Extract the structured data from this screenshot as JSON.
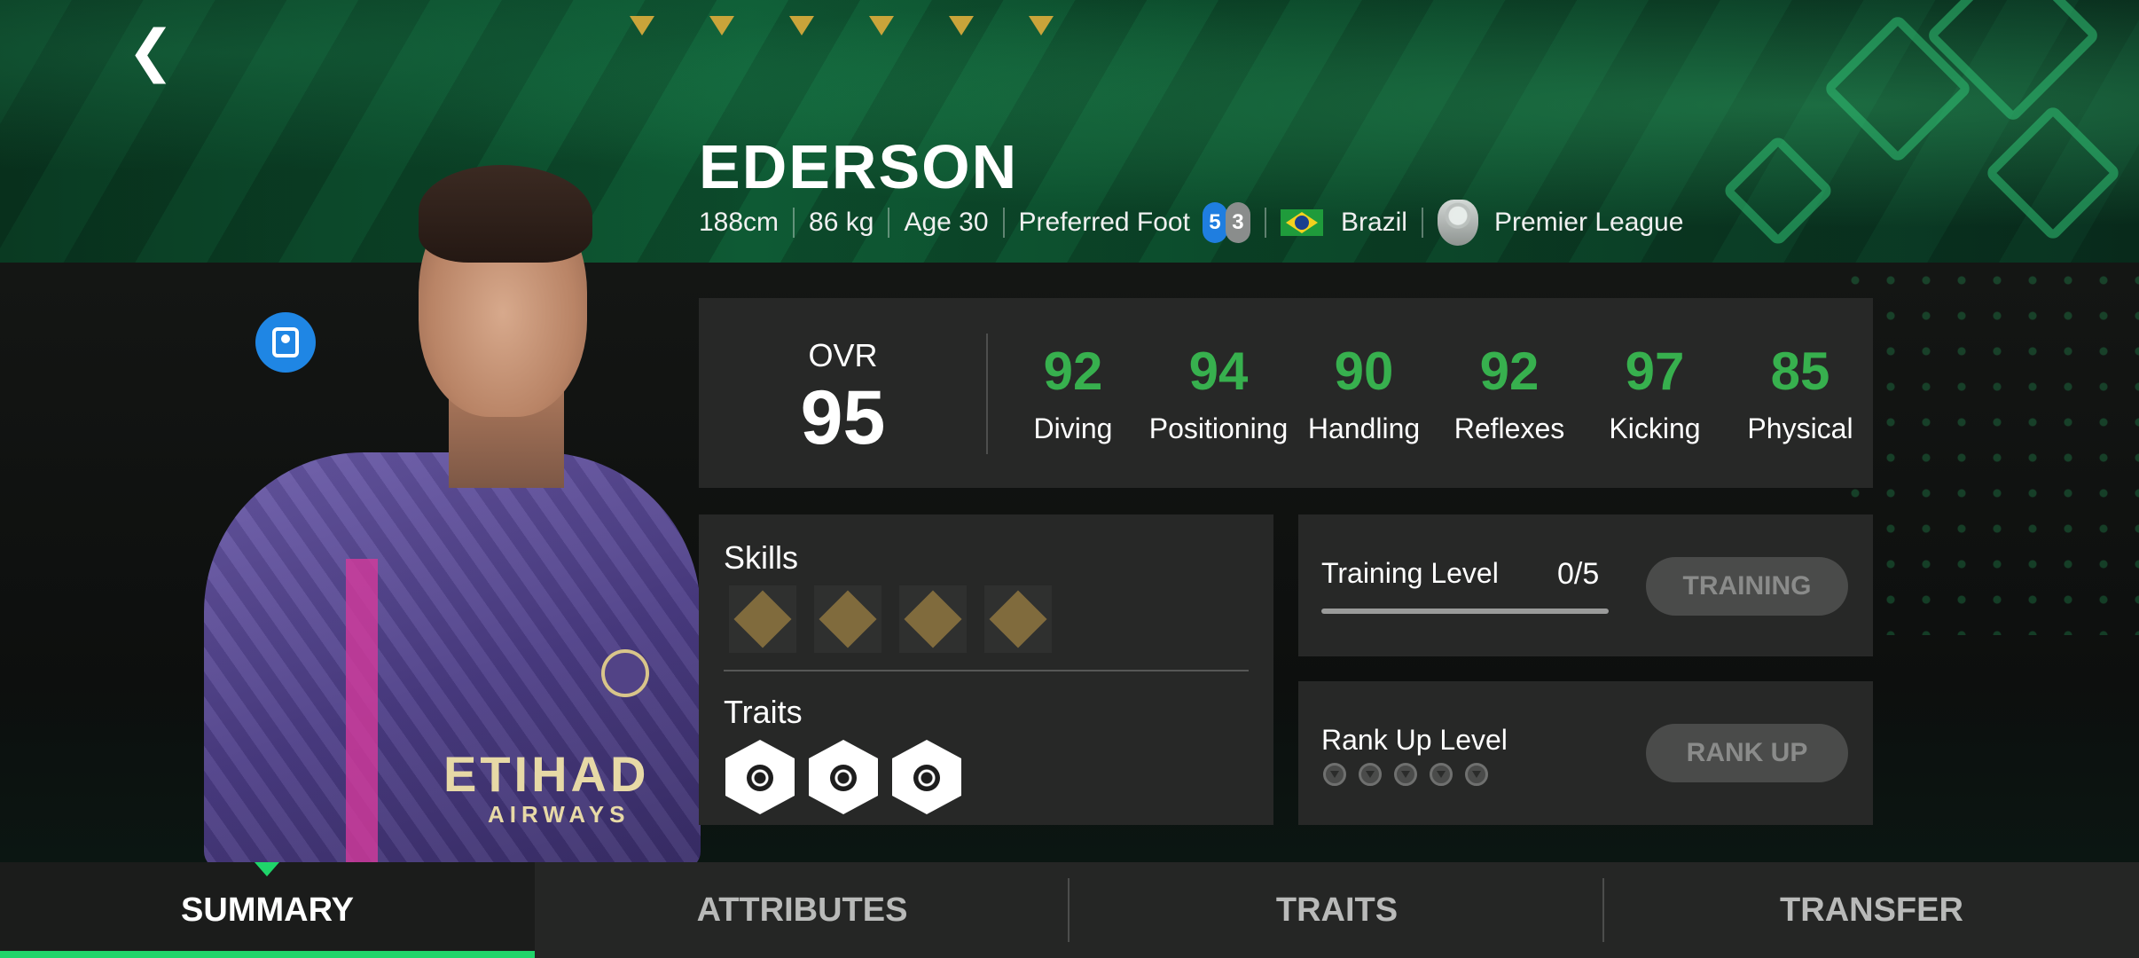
{
  "header": {
    "back_icon": "chevron-left-icon",
    "stars_count": 6,
    "star_color": "#c9a43a"
  },
  "player": {
    "name": "EDERSON",
    "height": "188cm",
    "weight": "86 kg",
    "age": "Age 30",
    "preferred_foot_label": "Preferred Foot",
    "foot_left": "5",
    "foot_right": "3",
    "nation": "Brazil",
    "league": "Premier League",
    "shirt_sponsor": "ETIHAD",
    "shirt_sponsor_sub": "AIRWAYS"
  },
  "ratings": {
    "ovr_label": "OVR",
    "ovr_value": "95",
    "stats": [
      {
        "label": "Diving",
        "value": "92"
      },
      {
        "label": "Positioning",
        "value": "94"
      },
      {
        "label": "Handling",
        "value": "90"
      },
      {
        "label": "Reflexes",
        "value": "92"
      },
      {
        "label": "Kicking",
        "value": "97"
      },
      {
        "label": "Physical",
        "value": "85"
      }
    ],
    "stat_color": "#37b04e"
  },
  "skills": {
    "title": "Skills",
    "icons": [
      "glove-dive-icon",
      "punch-arrow-icon",
      "goal-keeper-icon",
      "goal-net-icon"
    ]
  },
  "traits": {
    "title": "Traits",
    "icons": [
      "ball-shot-icon",
      "keeper-arms-icon",
      "ball-kick-icon"
    ]
  },
  "training": {
    "label": "Training Level",
    "value": "0/5",
    "progress": 0,
    "button": "TRAINING"
  },
  "rank": {
    "label": "Rank Up Level",
    "levels": 5,
    "button": "RANK UP"
  },
  "tabs": [
    {
      "label": "SUMMARY",
      "active": true
    },
    {
      "label": "ATTRIBUTES",
      "active": false
    },
    {
      "label": "TRAITS",
      "active": false
    },
    {
      "label": "TRANSFER",
      "active": false
    }
  ],
  "colors": {
    "accent": "#1fd46a",
    "swap_button": "#1f86e4"
  }
}
